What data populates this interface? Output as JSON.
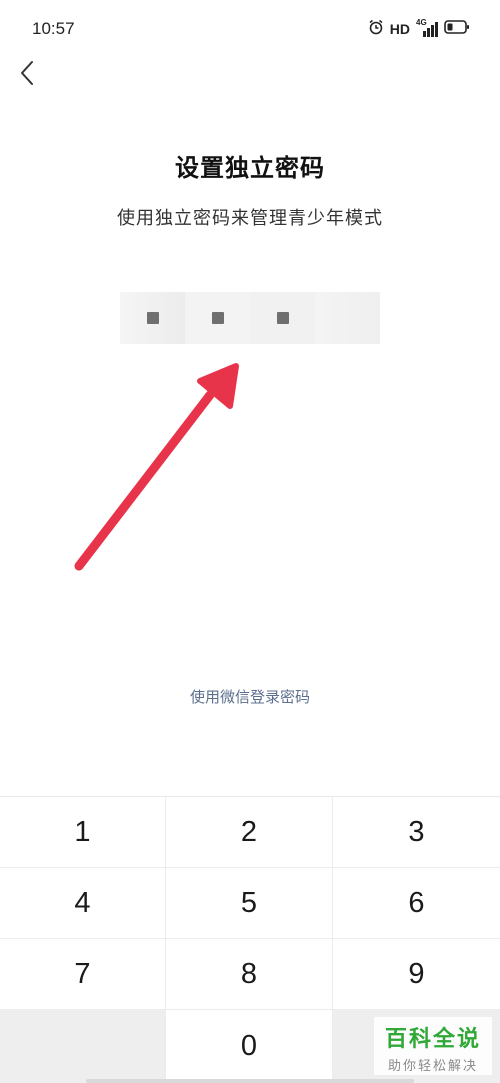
{
  "status_bar": {
    "time": "10:57",
    "hd_label": "HD",
    "network_label": "4G",
    "icons": [
      "alarm-icon",
      "signal-icon",
      "battery-icon"
    ]
  },
  "header": {
    "back_icon": "chevron-left-icon"
  },
  "main": {
    "title": "设置独立密码",
    "subtitle": "使用独立密码来管理青少年模式",
    "pin_entered": 3,
    "pin_length": 4,
    "wechat_link": "使用微信登录密码"
  },
  "keypad": {
    "keys": [
      "1",
      "2",
      "3",
      "4",
      "5",
      "6",
      "7",
      "8",
      "9",
      "",
      "0",
      ""
    ]
  },
  "annotation": {
    "arrow_color": "#e8344a"
  },
  "watermark": {
    "main": "百科全说",
    "sub": "助你轻松解决"
  },
  "colors": {
    "link": "#5c6f8f",
    "pin_dot": "#6f6f6f",
    "watermark_green": "#2fa836"
  }
}
